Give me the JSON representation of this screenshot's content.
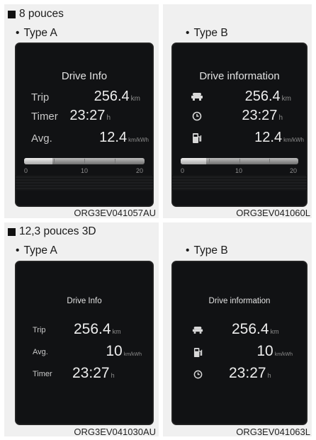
{
  "sections": [
    {
      "title": "8 pouces",
      "panels": [
        {
          "sub": "Type A",
          "code": "ORG3EV041057AU",
          "screen_title": "Drive Info",
          "rows": [
            {
              "label": "Trip",
              "value": "256.4",
              "unit": "km"
            },
            {
              "label": "Timer",
              "value": "23:27",
              "unit": "h"
            },
            {
              "label": "Avg.",
              "value": "12.4",
              "unit": "km/kWh"
            }
          ],
          "gauge": {
            "ticks": [
              "0",
              "10",
              "20"
            ],
            "level": 0.2
          }
        },
        {
          "sub": "Type B",
          "code": "ORG3EV041060L",
          "screen_title": "Drive information",
          "rows": [
            {
              "icon": "car-icon",
              "value": "256.4",
              "unit": "km"
            },
            {
              "icon": "clock-icon",
              "value": "23:27",
              "unit": "h"
            },
            {
              "icon": "charging-station-icon",
              "value": "12.4",
              "unit": "km/kWh"
            }
          ],
          "gauge": {
            "ticks": [
              "0",
              "10",
              "20"
            ],
            "level": 0.18
          }
        }
      ]
    },
    {
      "title": "12,3 pouces 3D",
      "panels": [
        {
          "sub": "Type A",
          "code": "ORG3EV041030AU",
          "screen_title": "Drive Info",
          "rows": [
            {
              "label": "Trip",
              "value": "256.4",
              "unit": "km"
            },
            {
              "label": "Avg.",
              "value": "10",
              "unit": "km/kWh"
            },
            {
              "label": "Timer",
              "value": "23:27",
              "unit": "h"
            }
          ]
        },
        {
          "sub": "Type B",
          "code": "ORG3EV041063L",
          "screen_title": "Drive information",
          "rows": [
            {
              "icon": "car-icon",
              "value": "256.4",
              "unit": "km"
            },
            {
              "icon": "charging-station-icon",
              "value": "10",
              "unit": "km/kWh"
            },
            {
              "icon": "clock-icon",
              "value": "23:27",
              "unit": "h"
            }
          ]
        }
      ]
    }
  ],
  "bullet": "•",
  "colors": {
    "screen_bg": "#111214",
    "cell_bg": "#f0f0f0",
    "text_light": "#ededed",
    "unit_gray": "#8d8d8d"
  }
}
